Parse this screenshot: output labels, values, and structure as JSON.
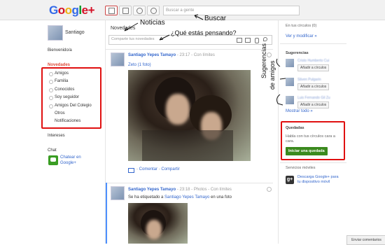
{
  "topbar": {
    "logo_letters": [
      "G",
      "o",
      "o",
      "g",
      "l",
      "e",
      "+"
    ],
    "logo_colors": [
      "#3369e8",
      "#d50f25",
      "#eeb211",
      "#3369e8",
      "#009925",
      "#d50f25",
      "#d50f25"
    ],
    "search_placeholder": "Buscar a gente"
  },
  "left": {
    "profile_name": "Santiago",
    "welcome": "Bienvenido/a",
    "stream_title": "Novedades",
    "circles": [
      "Amigos",
      "Familia",
      "Conocidos",
      "Soy seguidor",
      "Amigos Del Colegio",
      "Otros",
      "Notificaciones"
    ],
    "interests": "Intereses",
    "chat_title": "Chat",
    "chat_link_1": "Chatear en",
    "chat_link_2": "Google+"
  },
  "main": {
    "header_title": "Novedades",
    "share_placeholder": "Comparte tus novedades",
    "post1": {
      "author": "Santiago Yepes Tamayo",
      "time": "23:17",
      "visibility": "Con límites",
      "album": "Zeto (1 foto)",
      "comment": "Comentar",
      "share": "Compartir"
    },
    "post2": {
      "author": "Santiago Yepes Tamayo",
      "time": "23:18",
      "type": "Photos",
      "visibility": "Con límites",
      "text_prefix": "Se ha etiquetado a ",
      "text_link": "Santiago Yepes Tamayo",
      "text_suffix": " en una foto"
    }
  },
  "right": {
    "circles_label": "En tus círculos (0)",
    "view_edit": "Ver y modificar »",
    "suggestions_title": "Sugerencias",
    "suggestions": [
      {
        "name": "Cristo Humberto Cui",
        "button": "Añadir a círculos"
      },
      {
        "name": "Stiven Pulgarin",
        "button": "Añadir a círculos"
      },
      {
        "name": "Luis Fernando Gil Zu",
        "button": "Añadir a círculos"
      }
    ],
    "show_all": "Mostrar todo »",
    "hangouts_title": "Quedadas",
    "hangouts_text": "Habla con tus círculos cara a cara.",
    "hangouts_button": "Iniciar una quedada",
    "mobile_title": "Servicios móviles",
    "mobile_link": "Descarga Google+ para tu dispositivo móvil",
    "feedback": "Enviar comentarios"
  },
  "annotations": {
    "noticias": "Noticias",
    "buscar": "Buscar",
    "novedades": "Novedades",
    "que_estas": "¿Qué estás pensando?",
    "sugerencias_1": "Sugerencias",
    "sugerencias_2": "de amigos"
  }
}
